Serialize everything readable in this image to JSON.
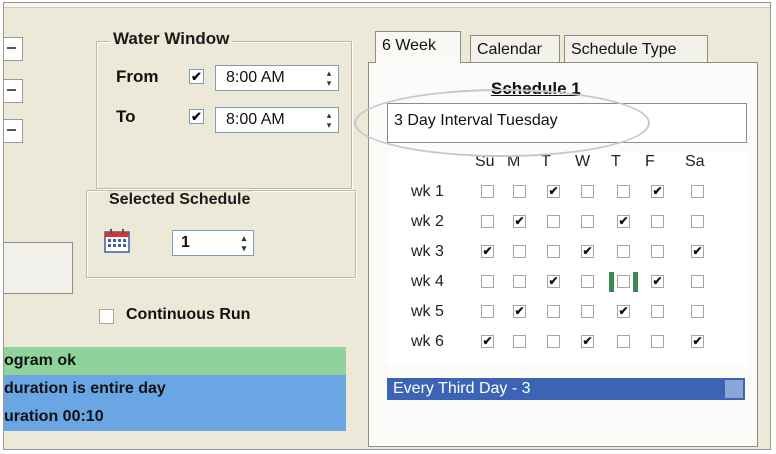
{
  "water_window": {
    "title": "Water Window",
    "from_label": "From",
    "to_label": "To",
    "from_checked": "✔",
    "to_checked": "✔",
    "from_time": "8:00 AM",
    "to_time": "8:00 AM",
    "spin_up": "▴",
    "spin_down": "▾"
  },
  "selected_schedule": {
    "title": "Selected Schedule",
    "value": "1",
    "spin_up": "▴",
    "spin_down": "▾"
  },
  "continuous_run": {
    "label": "Continuous Run",
    "checked": false
  },
  "status_lines": [
    {
      "text": "ogram ok",
      "color": "#8fd39b"
    },
    {
      "text": " duration is entire day",
      "color": "#6aa6e4"
    },
    {
      "text": "uration 00:10",
      "color": "#6aa6e4"
    }
  ],
  "tabs": [
    {
      "label": "6 Week",
      "active": true
    },
    {
      "label": "Calendar",
      "active": false
    },
    {
      "label": "Schedule Type",
      "active": false
    }
  ],
  "schedule": {
    "title": "Schedule 1",
    "name": "3 Day Interval Tuesday",
    "days": [
      "Su",
      "M",
      "T",
      "W",
      "T",
      "F",
      "Sa"
    ],
    "weeks": [
      {
        "label": "wk 1",
        "checks": [
          0,
          0,
          1,
          0,
          0,
          1,
          0
        ]
      },
      {
        "label": "wk 2",
        "checks": [
          0,
          1,
          0,
          0,
          1,
          0,
          0
        ]
      },
      {
        "label": "wk 3",
        "checks": [
          1,
          0,
          0,
          1,
          0,
          0,
          1
        ]
      },
      {
        "label": "wk 4",
        "checks": [
          0,
          0,
          1,
          0,
          0,
          1,
          0
        ]
      },
      {
        "label": "wk 5",
        "checks": [
          0,
          1,
          0,
          0,
          1,
          0,
          0
        ]
      },
      {
        "label": "wk 6",
        "checks": [
          1,
          0,
          0,
          1,
          0,
          0,
          1
        ]
      }
    ],
    "check_glyph": "✔",
    "type_label": "Every Third Day - 3"
  }
}
